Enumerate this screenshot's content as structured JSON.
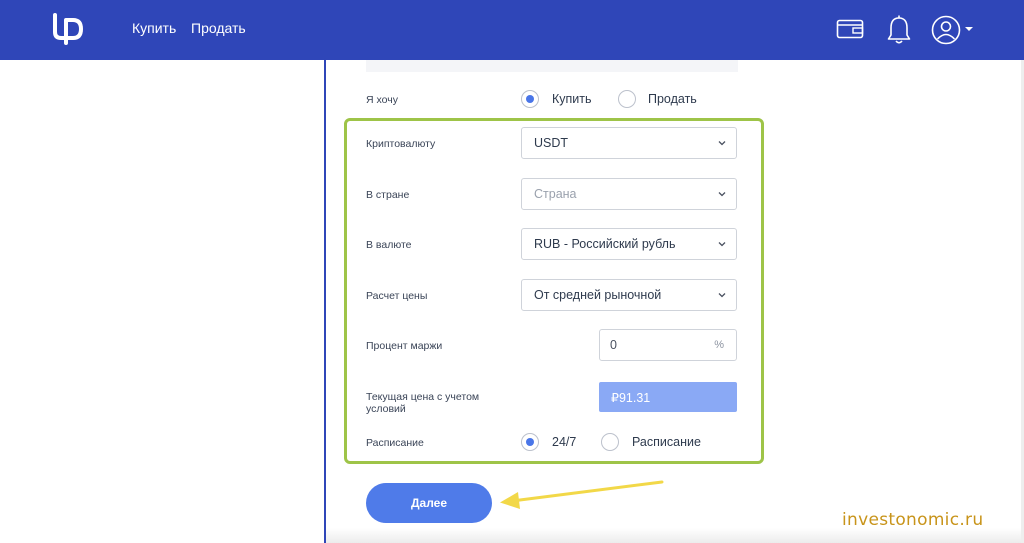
{
  "nav": {
    "buy": "Купить",
    "sell": "Продать"
  },
  "icons": {
    "logo": "logo-icon",
    "wallet": "wallet-icon",
    "bell": "bell-icon",
    "profile": "user-circle-icon",
    "caret": "caret-down-icon"
  },
  "form": {
    "want_label": "Я хочу",
    "want_options": [
      {
        "label": "Купить",
        "selected": true
      },
      {
        "label": "Продать",
        "selected": false
      }
    ],
    "crypto_label": "Криптовалюту",
    "crypto_value": "USDT",
    "country_label": "В стране",
    "country_placeholder": "Страна",
    "currency_label": "В валюте",
    "currency_value": "RUB - Российский рубль",
    "price_calc_label": "Расчет цены",
    "price_calc_value": "От средней рыночной",
    "margin_label": "Процент маржи",
    "margin_value": "0",
    "margin_unit": "%",
    "current_price_label": "Текущая цена с учетом условий",
    "current_price_value": "₽91.31",
    "schedule_label": "Расписание",
    "schedule_options": [
      {
        "label": "24/7",
        "selected": true
      },
      {
        "label": "Расписание",
        "selected": false
      }
    ],
    "next_button": "Далее"
  },
  "watermark": "investonomic.ru",
  "colors": {
    "nav_bg": "#2f46b8",
    "accent": "#4f7be9",
    "frame": "#9ec448",
    "arrow": "#f2d848",
    "watermark": "#c8941a"
  }
}
